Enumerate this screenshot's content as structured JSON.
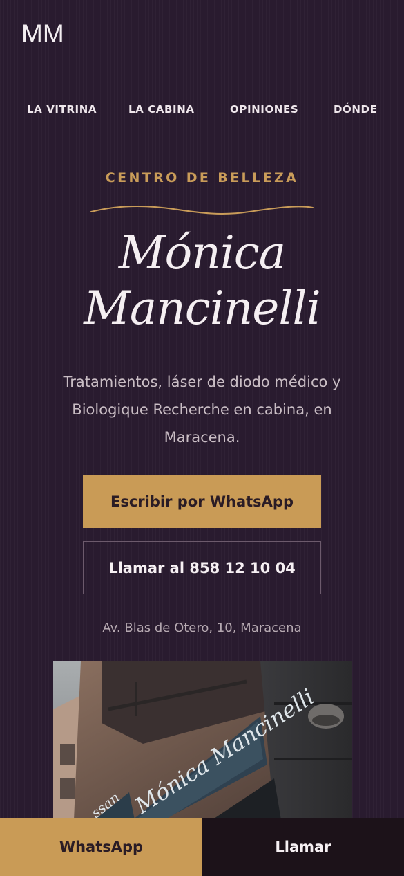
{
  "header": {
    "logo": "MM"
  },
  "nav": {
    "items": [
      {
        "label": "LA VITRINA"
      },
      {
        "label": "LA CABINA"
      },
      {
        "label": "OPINIONES"
      },
      {
        "label": "DÓNDE"
      }
    ]
  },
  "hero": {
    "eyebrow": "CENTRO DE BELLEZA",
    "title_line1": "Mónica",
    "title_line2": "Mancinelli",
    "subtitle": "Tratamientos, láser de diodo médico y Biologique Recherche en cabina, en Maracena.",
    "whatsapp_button": "Escribir por WhatsApp",
    "call_button": "Llamar al 858 12 10 04",
    "address": "Av. Blas de Otero, 10, Maracena"
  },
  "storefront_photo": {
    "sign_text": "Mónica Mancinelli",
    "small_sign_text": "ssan"
  },
  "bottom_bar": {
    "whatsapp": "WhatsApp",
    "call": "Llamar"
  },
  "colors": {
    "background": "#291b2f",
    "gold": "#c99b56",
    "text_light": "#f5eff2"
  }
}
